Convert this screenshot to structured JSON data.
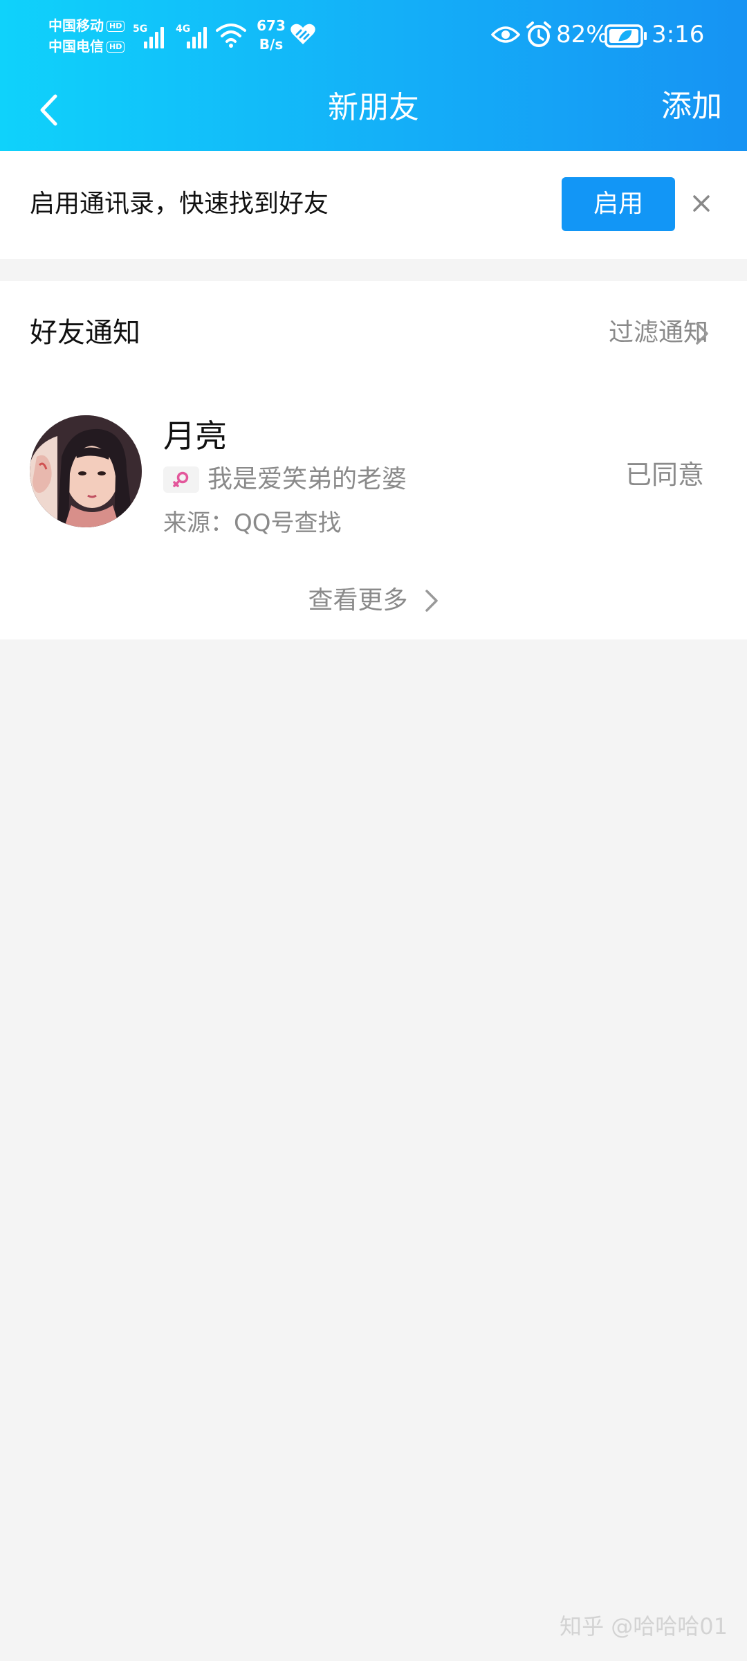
{
  "status_bar": {
    "carrier1": "中国移动",
    "carrier2": "中国电信",
    "hd_tag": "HD",
    "network1": "5G",
    "network2": "4G",
    "net_speed_value": "673",
    "net_speed_unit": "B/s",
    "battery_percent": "82%",
    "time": "3:16"
  },
  "nav": {
    "title": "新朋友",
    "add_label": "添加"
  },
  "contacts_banner": {
    "text": "启用通讯录，快速找到好友",
    "enable_label": "启用"
  },
  "friend_notifications": {
    "title": "好友通知",
    "filter_label": "过滤通知",
    "requests": [
      {
        "name": "月亮",
        "message": "我是爱笑弟的老婆",
        "source": "来源：QQ号查找",
        "status": "已同意"
      }
    ],
    "see_more_label": "查看更多"
  },
  "watermark": "知乎 @哈哈哈01",
  "colors": {
    "header_gradient_start": "#0fd2fb",
    "header_gradient_end": "#1693f3",
    "primary_button": "#1296f6",
    "secondary_text": "#8a8a8a",
    "page_background": "#f4f4f4"
  }
}
